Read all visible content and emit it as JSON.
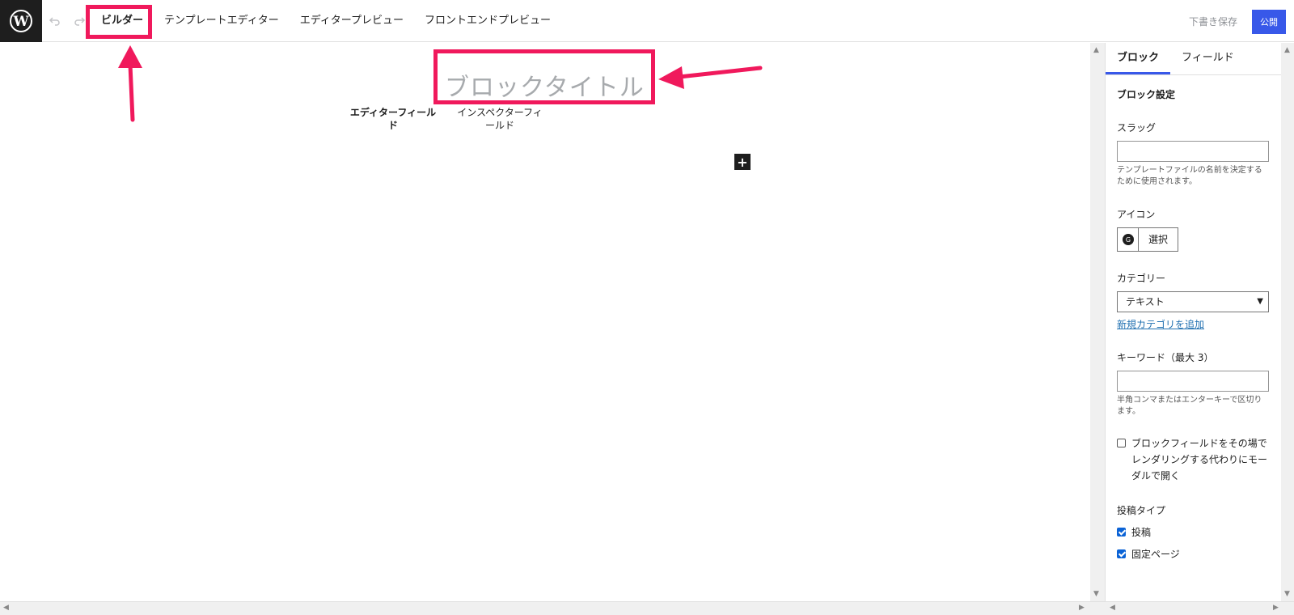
{
  "header": {
    "tabs": [
      "ビルダー",
      "テンプレートエディター",
      "エディタープレビュー",
      "フロントエンドプレビュー"
    ],
    "save_draft": "下書き保存",
    "publish": "公開"
  },
  "canvas": {
    "block_title_placeholder": "ブロックタイトル",
    "field_tabs": [
      "エディターフィールド",
      "インスペクターフィールド"
    ],
    "add_block": "+"
  },
  "sidebar": {
    "tabs": [
      "ブロック",
      "フィールド"
    ],
    "section_title": "ブロック設定",
    "slug_label": "スラッグ",
    "slug_help": "テンプレートファイルの名前を決定するために使用されます。",
    "icon_label": "アイコン",
    "icon_select": "選択",
    "category_label": "カテゴリー",
    "category_value": "テキスト",
    "add_category_link": "新規カテゴリを追加",
    "keyword_label": "キーワード（最大 3）",
    "keyword_help": "半角コンマまたはエンターキーで区切ります。",
    "modal_option": "ブロックフィールドをその場でレンダリングする代わりにモーダルで開く",
    "post_type_label": "投稿タイプ",
    "post_types": [
      "投稿",
      "固定ページ"
    ]
  }
}
